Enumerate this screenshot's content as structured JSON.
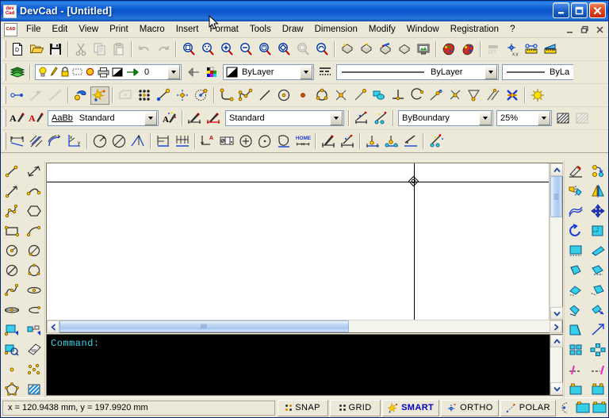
{
  "app": {
    "title": "DevCad - [Untitled]",
    "icon": "devcad-logo-icon"
  },
  "titlebar": {
    "minimize_label": "_",
    "maximize_label": "❐",
    "close_label": "✕"
  },
  "menubar": {
    "items": [
      {
        "label": "File"
      },
      {
        "label": "Edit"
      },
      {
        "label": "View"
      },
      {
        "label": "Print"
      },
      {
        "label": "Macro"
      },
      {
        "label": "Insert"
      },
      {
        "label": "Format"
      },
      {
        "label": "Tools"
      },
      {
        "label": "Draw"
      },
      {
        "label": "Dimension"
      },
      {
        "label": "Modify"
      },
      {
        "label": "Window"
      },
      {
        "label": "Registration"
      },
      {
        "label": "?"
      }
    ],
    "mdi": {
      "minimize": "_",
      "restore": "❐",
      "close": "✕"
    }
  },
  "toolbar_standard": {
    "buttons": [
      {
        "name": "new-file-icon",
        "enabled": true
      },
      {
        "name": "open-file-icon",
        "enabled": true
      },
      {
        "name": "save-file-icon",
        "enabled": true
      },
      {
        "name": "cut-icon",
        "enabled": false
      },
      {
        "name": "copy-icon",
        "enabled": false
      },
      {
        "name": "paste-icon",
        "enabled": false
      },
      {
        "name": "undo-icon",
        "enabled": false
      },
      {
        "name": "redo-icon",
        "enabled": false
      },
      {
        "name": "zoom-window-icon",
        "enabled": true
      },
      {
        "name": "zoom-all-icon",
        "enabled": true
      },
      {
        "name": "zoom-in-icon",
        "enabled": true
      },
      {
        "name": "zoom-out-icon",
        "enabled": true
      },
      {
        "name": "zoom-previous-icon",
        "enabled": true
      },
      {
        "name": "zoom-dynamic-icon",
        "enabled": true
      },
      {
        "name": "zoom-extents-icon",
        "enabled": false
      },
      {
        "name": "pan-icon",
        "enabled": true
      },
      {
        "name": "render-shade-icon",
        "enabled": true
      },
      {
        "name": "render-wire-icon",
        "enabled": true
      },
      {
        "name": "render-color-icon",
        "enabled": true
      },
      {
        "name": "render-hidden-icon",
        "enabled": true
      },
      {
        "name": "display-monitor-icon",
        "enabled": true
      },
      {
        "name": "properties-paint-icon",
        "enabled": true
      },
      {
        "name": "match-properties-icon",
        "enabled": true
      },
      {
        "name": "layer-list-icon",
        "enabled": false
      },
      {
        "name": "coordinate-xy-icon",
        "enabled": true
      },
      {
        "name": "measure-distance-icon",
        "enabled": true
      },
      {
        "name": "measure-area-icon",
        "enabled": true
      }
    ]
  },
  "toolbar_properties": {
    "layers_icon": "layers-icon",
    "layer_state_icons": [
      "lightbulb-on-icon",
      "freeze-pen-icon",
      "lock-icon",
      "marquee-icon",
      "color-circle-icon",
      "plot-printer-icon",
      "layer-color-icon",
      "current-layer-arrow-icon"
    ],
    "current_layer": "0",
    "make_current_icon": "make-layer-current-icon",
    "color_palette_icon": "color-palette-icon",
    "color_value": "ByLayer",
    "linetype_manager_icon": "linetype-manager-icon",
    "linetype_value": "ByLayer",
    "lineweight_value": "ByLa"
  },
  "toolbar_draw": {
    "buttons": [
      {
        "name": "point-snap-icon",
        "enabled": true
      },
      {
        "name": "snap-midpoint-icon",
        "enabled": false
      },
      {
        "name": "snap-nearest-icon",
        "enabled": false
      },
      {
        "name": "object-snap-settings-icon",
        "enabled": true
      },
      {
        "name": "smart-snap-icon",
        "enabled": true,
        "pressed": true
      },
      {
        "name": "snap-from-icon",
        "enabled": false
      },
      {
        "name": "snap-grid-icon",
        "enabled": true
      },
      {
        "name": "snap-endpoint-icon",
        "enabled": true
      },
      {
        "name": "snap-intersection-icon",
        "enabled": true
      },
      {
        "name": "snap-center-icon",
        "enabled": true
      },
      {
        "name": "polyline-icon",
        "enabled": true
      },
      {
        "name": "spline-icon",
        "enabled": true
      },
      {
        "name": "line-icon",
        "enabled": true
      },
      {
        "name": "circle-icon",
        "enabled": true
      },
      {
        "name": "circle-center-icon",
        "enabled": true
      },
      {
        "name": "point-icon",
        "enabled": true
      },
      {
        "name": "circle-3point-icon",
        "enabled": true
      },
      {
        "name": "snap-node-icon",
        "enabled": true
      },
      {
        "name": "ray-icon",
        "enabled": true
      },
      {
        "name": "region-icon",
        "enabled": true
      },
      {
        "name": "perpendicular-icon",
        "enabled": true
      },
      {
        "name": "arc-icon",
        "enabled": true
      },
      {
        "name": "tangent-icon",
        "enabled": true
      },
      {
        "name": "intersect-icon",
        "enabled": true
      },
      {
        "name": "angle-icon",
        "enabled": true
      },
      {
        "name": "parallel-icon",
        "enabled": true
      },
      {
        "name": "trim-cross-icon",
        "enabled": true
      },
      {
        "name": "smart-point-icon",
        "enabled": true
      }
    ]
  },
  "toolbar_text": {
    "text_style_icon": "text-style-icon",
    "text_style_red_icon": "text-style-red-icon",
    "font_preview": "AaBb",
    "text_style_value": "Standard",
    "text_magic_icon": "text-effects-icon",
    "dim_style_icon": "dimension-style-icon",
    "dim_style_red_icon": "dimension-style-red-icon",
    "dim_style_value": "Standard",
    "dim_update_icon": "dimension-update-icon",
    "dim_magic_icon": "dimension-effects-icon",
    "hatch_boundary_value": "ByBoundary",
    "hatch_scale_value": "25%",
    "hatch_pattern_icon": "hatch-pattern-icon",
    "hatch_pattern2_icon": "hatch-pattern-light-icon"
  },
  "toolbar_dimension": {
    "buttons": [
      {
        "name": "dim-linear-icon",
        "enabled": true
      },
      {
        "name": "dim-aligned-icon",
        "enabled": true
      },
      {
        "name": "dim-arc-length-icon",
        "enabled": true
      },
      {
        "name": "dim-ordinate-icon",
        "enabled": true
      },
      {
        "name": "dim-angular-icon",
        "enabled": true
      },
      {
        "name": "dim-diameter-icon",
        "enabled": true
      },
      {
        "name": "dim-radius-icon",
        "enabled": true
      },
      {
        "name": "dim-baseline-icon",
        "enabled": true
      },
      {
        "name": "dim-continue-icon",
        "enabled": true
      },
      {
        "name": "dim-leader-icon",
        "enabled": true
      },
      {
        "name": "dim-tolerance-icon",
        "enabled": true
      },
      {
        "name": "dim-center-mark-icon",
        "enabled": true
      },
      {
        "name": "dim-area-icon",
        "enabled": true
      },
      {
        "name": "dim-polygon-icon",
        "enabled": true
      },
      {
        "name": "dim-home-icon",
        "enabled": true
      },
      {
        "name": "dim-style-apply-icon",
        "enabled": true
      },
      {
        "name": "dim-edit-text-icon",
        "enabled": true
      },
      {
        "name": "dim-oblique-icon",
        "enabled": true
      },
      {
        "name": "dim-override-icon",
        "enabled": true
      },
      {
        "name": "dim-update-line-icon",
        "enabled": true
      },
      {
        "name": "dim-smart-icon",
        "enabled": true
      }
    ]
  },
  "left_toolbar": {
    "buttons": [
      {
        "name": "line-segment-icon"
      },
      {
        "name": "line-double-arrow-icon"
      },
      {
        "name": "ray-line-icon"
      },
      {
        "name": "curve-line-icon"
      },
      {
        "name": "polyline-multi-icon"
      },
      {
        "name": "polygon-hexagon-icon"
      },
      {
        "name": "rectangle-icon"
      },
      {
        "name": "arc-3point-icon"
      },
      {
        "name": "circle-radius-icon"
      },
      {
        "name": "circle-diameter-icon"
      },
      {
        "name": "circle-tangent-icon"
      },
      {
        "name": "circle-3point-icon"
      },
      {
        "name": "spline-curve-icon"
      },
      {
        "name": "ellipse-icon"
      },
      {
        "name": "ellipse-axis-icon"
      },
      {
        "name": "elliptical-arc-icon"
      },
      {
        "name": "insert-block-icon"
      },
      {
        "name": "insert-attribute-icon"
      },
      {
        "name": "insert-image-icon"
      },
      {
        "name": "multiline-text-icon"
      },
      {
        "name": "point-single-icon"
      },
      {
        "name": "point-multiple-icon"
      },
      {
        "name": "region-boundary-icon"
      },
      {
        "name": "hatch-fill-icon"
      }
    ]
  },
  "right_toolbar": {
    "buttons": [
      {
        "name": "erase-icon"
      },
      {
        "name": "copy-object-icon"
      },
      {
        "name": "mirror-icon"
      },
      {
        "name": "mirror-axis-icon"
      },
      {
        "name": "offset-icon"
      },
      {
        "name": "move-icon"
      },
      {
        "name": "rotate-icon"
      },
      {
        "name": "scale-icon"
      },
      {
        "name": "stretch-icon"
      },
      {
        "name": "trim-icon"
      },
      {
        "name": "extend-icon"
      },
      {
        "name": "break-icon"
      },
      {
        "name": "chamfer-icon"
      },
      {
        "name": "fillet-icon"
      },
      {
        "name": "explode-icon"
      },
      {
        "name": "join-icon"
      },
      {
        "name": "align-icon"
      },
      {
        "name": "lengthen-icon"
      },
      {
        "name": "array-rectangular-icon"
      },
      {
        "name": "array-polar-icon"
      },
      {
        "name": "divide-icon"
      },
      {
        "name": "measure-icon"
      },
      {
        "name": "block-edit-icon"
      },
      {
        "name": "block-insert-icon"
      }
    ]
  },
  "command_window": {
    "text": "Command:"
  },
  "statusbar": {
    "coordinates": "x = 120.9438 mm, y = 197.9920 mm",
    "panes": [
      {
        "label": "SNAP",
        "active": false,
        "icon": "snap-dots-icon"
      },
      {
        "label": "GRID",
        "active": false,
        "icon": "grid-dots-icon"
      },
      {
        "label": "SMART",
        "active": true,
        "icon": "smart-star-icon"
      },
      {
        "label": "ORTHO",
        "active": false,
        "icon": "ortho-cross-icon"
      },
      {
        "label": "POLAR",
        "active": false,
        "icon": "polar-line-icon"
      }
    ],
    "trailing_icons": [
      "polar-tracking-icon",
      "model-space-icon",
      "paper-space-icon"
    ]
  },
  "colors": {
    "title_blue": "#0a5ad2",
    "face": "#ece9d8",
    "canvas": "#ffffff",
    "command_bg": "#000000",
    "command_fg": "#35d9e8",
    "active_status": "#0000c8",
    "scrollbar_thumb": "#a8c7ef"
  }
}
